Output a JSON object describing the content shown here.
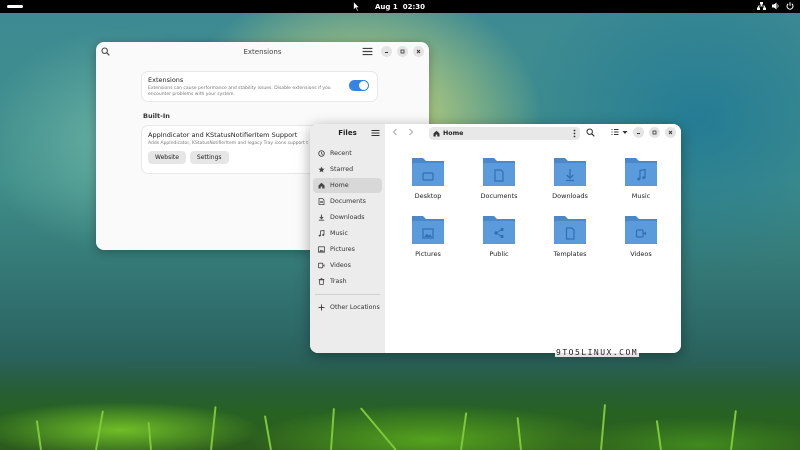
{
  "topbar": {
    "date": "Aug 1",
    "time": "02:30"
  },
  "extensions_window": {
    "title": "Extensions",
    "master": {
      "title": "Extensions",
      "description": "Extensions can cause performance and stability issues. Disable extensions if you encounter problems with your system.",
      "enabled": true
    },
    "section_label": "Built-In",
    "item": {
      "title": "AppIndicator and KStatusNotifierItem Support",
      "description": "Adds AppIndicator, KStatusNotifierItem and legacy Tray icons support t",
      "website_label": "Website",
      "settings_label": "Settings"
    }
  },
  "files_window": {
    "sidebar_title": "Files",
    "sidebar_items": [
      {
        "label": "Recent",
        "icon": "clock-icon"
      },
      {
        "label": "Starred",
        "icon": "star-icon"
      },
      {
        "label": "Home",
        "icon": "home-icon",
        "active": true
      },
      {
        "label": "Documents",
        "icon": "document-icon"
      },
      {
        "label": "Downloads",
        "icon": "download-icon"
      },
      {
        "label": "Music",
        "icon": "music-icon"
      },
      {
        "label": "Pictures",
        "icon": "picture-icon"
      },
      {
        "label": "Videos",
        "icon": "video-icon"
      },
      {
        "label": "Trash",
        "icon": "trash-icon"
      }
    ],
    "other_locations": "Other Locations",
    "path": "Home",
    "folders": [
      {
        "label": "Desktop",
        "icon": "desktop-folder-icon"
      },
      {
        "label": "Documents",
        "icon": "documents-folder-icon"
      },
      {
        "label": "Downloads",
        "icon": "downloads-folder-icon"
      },
      {
        "label": "Music",
        "icon": "music-folder-icon"
      },
      {
        "label": "Pictures",
        "icon": "pictures-folder-icon"
      },
      {
        "label": "Public",
        "icon": "public-folder-icon"
      },
      {
        "label": "Templates",
        "icon": "templates-folder-icon"
      },
      {
        "label": "Videos",
        "icon": "videos-folder-icon"
      }
    ]
  },
  "watermark": "9TO5LINUX.COM",
  "colors": {
    "accent": "#3584e4",
    "folder": "#5b9bdb",
    "folder_dark": "#4a88c9"
  }
}
